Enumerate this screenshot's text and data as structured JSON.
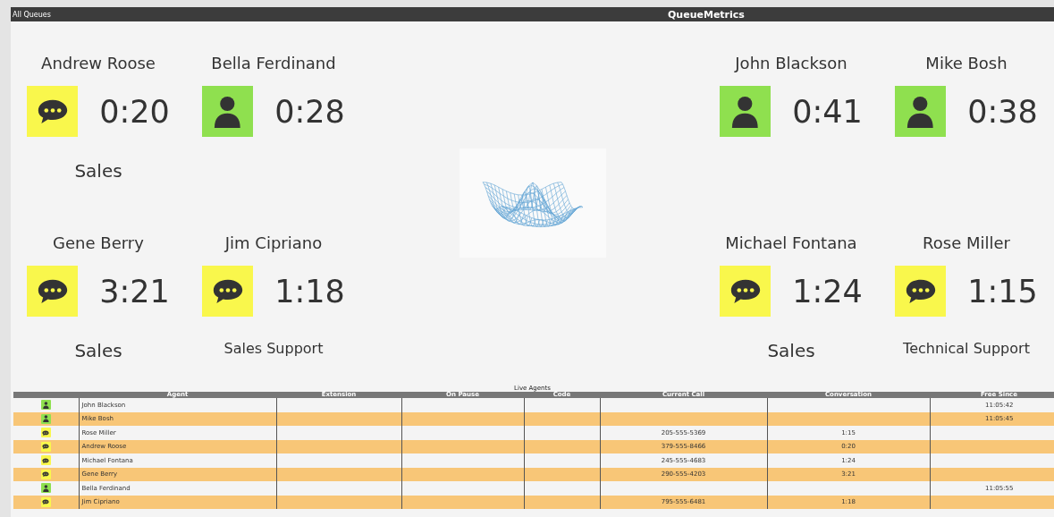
{
  "header": {
    "left": "All Queues",
    "title": "QueueMetrics"
  },
  "left_agents": [
    {
      "name": "Andrew Roose",
      "kind": "talking",
      "time": "0:20",
      "queue": "Sales"
    },
    {
      "name": "Bella Ferdinand",
      "kind": "free",
      "time": "0:28"
    },
    {
      "name": "Gene Berry",
      "kind": "talking",
      "time": "3:21",
      "queue": "Sales"
    },
    {
      "name": "Jim Cipriano",
      "kind": "talking",
      "time": "1:18",
      "queue": "Sales Support"
    }
  ],
  "right_agents": [
    {
      "name": "John Blackson",
      "kind": "free",
      "time": "0:41"
    },
    {
      "name": "Mike Bosh",
      "kind": "free",
      "time": "0:38"
    },
    {
      "name": "Michael Fontana",
      "kind": "talking",
      "time": "1:24",
      "queue": "Sales"
    },
    {
      "name": "Rose Miller",
      "kind": "talking",
      "time": "1:15",
      "queue": "Technical Support"
    }
  ],
  "table": {
    "caption": "Live Agents",
    "columns": [
      "Agent",
      "Extension",
      "On Pause",
      "Code",
      "Current Call",
      "Conversation",
      "Free Since"
    ],
    "rows": [
      {
        "kind": "free",
        "agent": "John Blackson",
        "free_since": "11:05:42"
      },
      {
        "kind": "free",
        "agent": "Mike Bosh",
        "free_since": "11:05:45"
      },
      {
        "kind": "talking",
        "agent": "Rose Miller",
        "current_call": "205-555-5369",
        "conversation": "1:15"
      },
      {
        "kind": "talking",
        "agent": "Andrew Roose",
        "current_call": "379-555-8466",
        "conversation": "0:20"
      },
      {
        "kind": "talking",
        "agent": "Michael Fontana",
        "current_call": "245-555-4683",
        "conversation": "1:24"
      },
      {
        "kind": "talking",
        "agent": "Gene Berry",
        "current_call": "290-555-4203",
        "conversation": "3:21"
      },
      {
        "kind": "free",
        "agent": "Bella Ferdinand",
        "free_since": "11:05:55"
      },
      {
        "kind": "talking",
        "agent": "Jim Cipriano",
        "current_call": "795-555-6481",
        "conversation": "1:18"
      }
    ]
  }
}
